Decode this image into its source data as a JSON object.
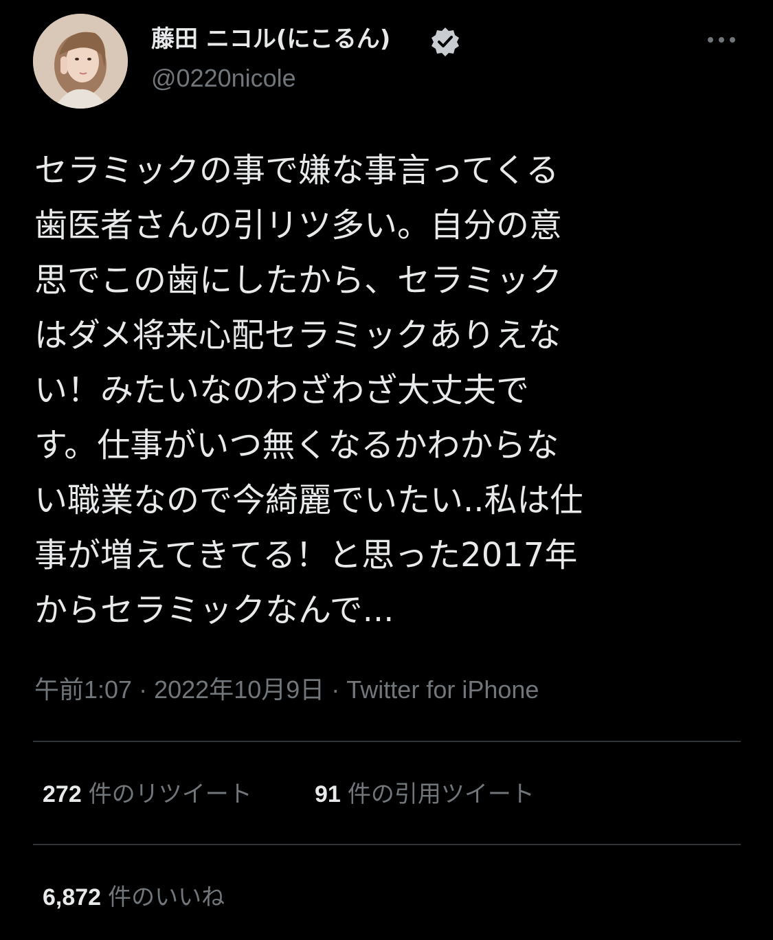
{
  "author": {
    "name": "藤田 ニコル(にこるん)",
    "handle": "@0220nicole",
    "verified_icon": "verified-badge-icon",
    "more_icon": "more-horizontal-icon"
  },
  "tweet": {
    "lines": [
      "セラミックの事で嫌な事言ってくる",
      "歯医者さんの引リツ多い。自分の意",
      "思でこの歯にしたから、セラミック",
      "はダメ将来心配セラミックありえな",
      "い！みたいなのわざわざ大丈夫で",
      "す。仕事がいつ無くなるかわからな",
      "い職業なので今綺麗でいたい..私は仕",
      "事が増えてきてる！と思った2017年",
      "からセラミックなんで..."
    ],
    "time": "午前1:07",
    "date": "2022年10月9日",
    "source": "Twitter for iPhone",
    "separator": "·"
  },
  "stats": {
    "retweets_count": "272",
    "retweets_label": "件のリツイート",
    "quotes_count": "91",
    "quotes_label": "件の引用ツイート",
    "likes_count": "6,872",
    "likes_label": "件のいいね"
  },
  "colors": {
    "background": "#000000",
    "primary_text": "#e7e9ea",
    "secondary_text": "#71767b",
    "divider": "#2f3336"
  }
}
